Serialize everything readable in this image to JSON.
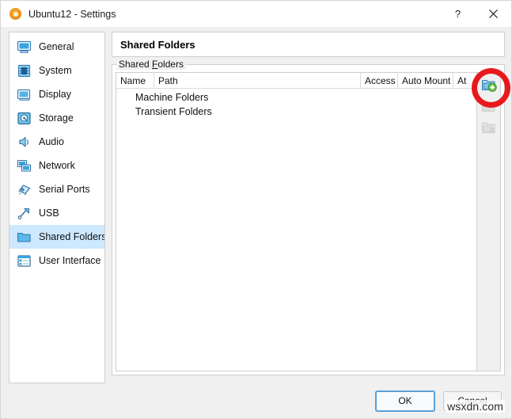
{
  "window": {
    "title": "Ubuntu12 - Settings",
    "app_icon": "virtualbox-ubuntu-icon",
    "help_button": "?",
    "close_button": "✕"
  },
  "sidebar": {
    "items": [
      {
        "label": "General",
        "icon": "general-monitor-icon",
        "selected": false
      },
      {
        "label": "System",
        "icon": "system-chip-icon",
        "selected": false
      },
      {
        "label": "Display",
        "icon": "display-monitor-icon",
        "selected": false
      },
      {
        "label": "Storage",
        "icon": "storage-disk-icon",
        "selected": false
      },
      {
        "label": "Audio",
        "icon": "audio-speaker-icon",
        "selected": false
      },
      {
        "label": "Network",
        "icon": "network-cards-icon",
        "selected": false
      },
      {
        "label": "Serial Ports",
        "icon": "serial-port-icon",
        "selected": false
      },
      {
        "label": "USB",
        "icon": "usb-plug-icon",
        "selected": false
      },
      {
        "label": "Shared Folders",
        "icon": "shared-folder-icon",
        "selected": true
      },
      {
        "label": "User Interface",
        "icon": "user-interface-icon",
        "selected": false
      }
    ]
  },
  "main": {
    "header_title": "Shared Folders",
    "groupbox_label_prefix": "Shared ",
    "groupbox_label_mnemonic": "F",
    "groupbox_label_suffix": "olders",
    "table": {
      "columns": [
        {
          "key": "name",
          "label": "Name"
        },
        {
          "key": "path",
          "label": "Path"
        },
        {
          "key": "access",
          "label": "Access"
        },
        {
          "key": "automount",
          "label": "Auto Mount"
        },
        {
          "key": "at",
          "label": "At"
        }
      ],
      "rows": [
        {
          "name": "Machine Folders"
        },
        {
          "name": "Transient Folders"
        }
      ]
    },
    "toolbar": [
      {
        "name": "add-shared-folder",
        "icon": "folder-plus-icon",
        "enabled": true,
        "highlighted": true
      },
      {
        "name": "edit-shared-folder",
        "icon": "folder-edit-icon",
        "enabled": false,
        "highlighted": false
      },
      {
        "name": "remove-shared-folder",
        "icon": "folder-remove-icon",
        "enabled": false,
        "highlighted": false
      }
    ]
  },
  "footer": {
    "ok_label": "OK",
    "cancel_label": "Cancel"
  },
  "watermark": "wsxdn.com",
  "colors": {
    "accent_selection": "#cde8ff",
    "annotation_red": "#e8191c",
    "dialog_bg": "#f0f0f0",
    "icon_blue": "#2f9ad6",
    "icon_green": "#5fba3f"
  }
}
